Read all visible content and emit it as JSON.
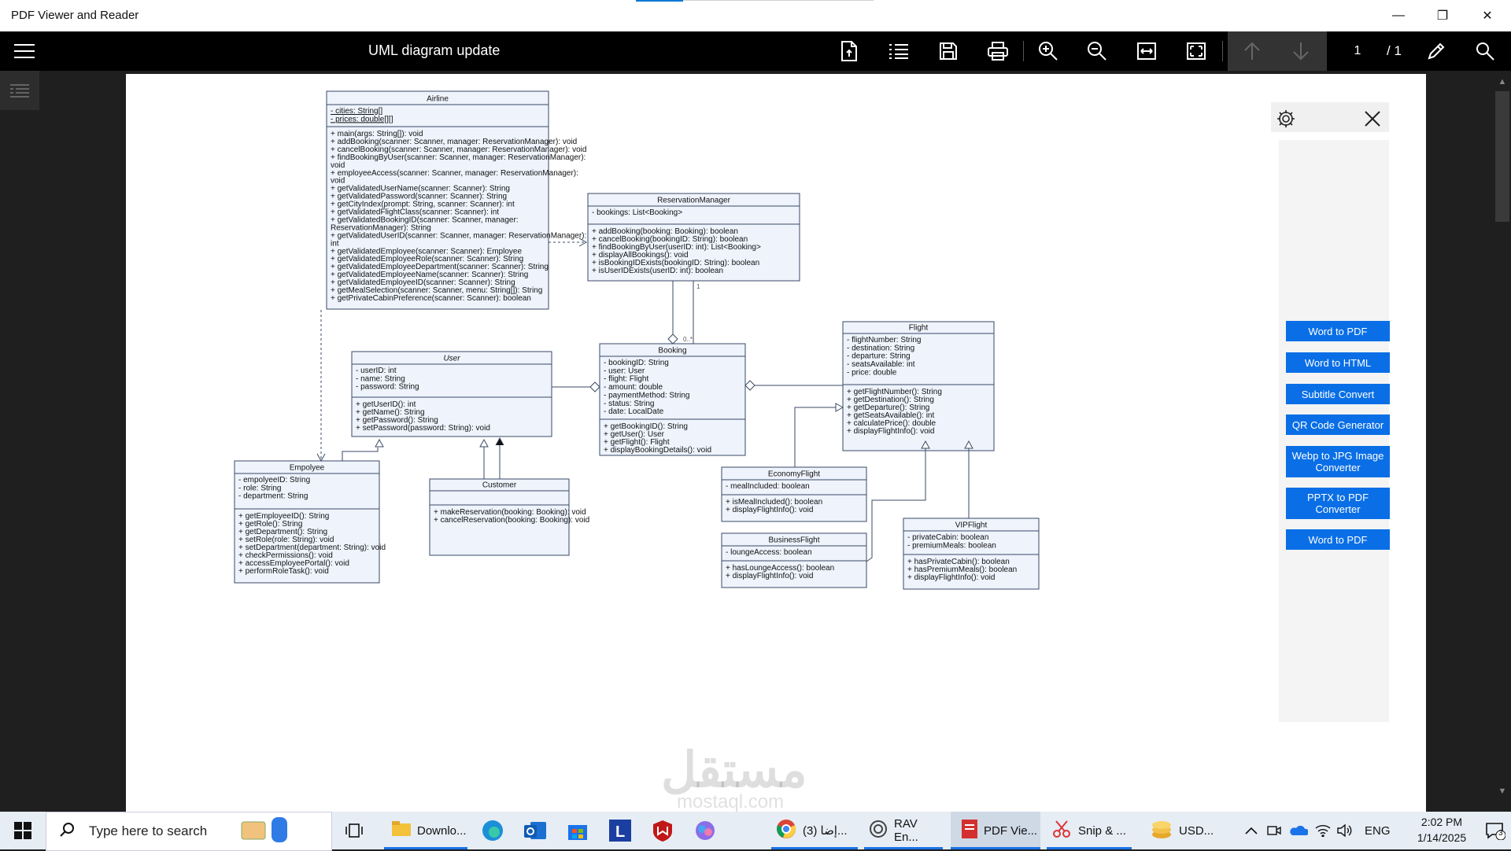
{
  "window": {
    "title": "PDF Viewer and Reader",
    "minimize": "—",
    "maximize": "❐",
    "close": "✕"
  },
  "toolbar": {
    "doc_title": "UML diagram update",
    "page_current": "1",
    "page_total": "/ 1"
  },
  "panel": {
    "buttons": [
      "Word to PDF",
      "Word to HTML",
      "Subtitle Convert",
      "QR Code Generator",
      "Webp to JPG Image Converter",
      "PPTX to PDF Converter",
      "Word to PDF"
    ]
  },
  "uml": {
    "airline": {
      "name": "Airline",
      "attrs": [
        "- cities: String[]",
        "- prices: double[][]"
      ],
      "methods": [
        "+ main(args: String[]): void",
        "+ addBooking(scanner: Scanner, manager: ReservationManager): void",
        "+ cancelBooking(scanner: Scanner, manager: ReservationManager): void",
        "+ findBookingByUser(scanner: Scanner, manager: ReservationManager):",
        "void",
        "+ employeeAccess(scanner: Scanner, manager: ReservationManager):",
        "void",
        "+ getValidatedUserName(scanner: Scanner): String",
        "+ getValidatedPassword(scanner: Scanner): String",
        "+ getCityIndex(prompt: String, scanner: Scanner): int",
        "+ getValidatedFlightClass(scanner: Scanner): int",
        "+ getValidatedBookingID(scanner: Scanner, manager:",
        "ReservationManager): String",
        "+ getValidatedUserID(scanner: Scanner, manager: ReservationManager):",
        "int",
        "+ getValidatedEmployee(scanner: Scanner): Employee",
        "+ getValidatedEmployeeRole(scanner: Scanner): String",
        "+ getValidatedEmployeeDepartment(scanner: Scanner): String",
        "+ getValidatedEmployeeName(scanner: Scanner): String",
        "+ getValidatedEmployeeID(scanner: Scanner): String",
        "+ getMealSelection(scanner: Scanner, menu: String[]): String",
        "+ getPrivateCabinPreference(scanner: Scanner): boolean"
      ]
    },
    "reservation": {
      "name": "ReservationManager",
      "attrs": [
        "- bookings: List<Booking>"
      ],
      "methods": [
        "+ addBooking(booking: Booking): boolean",
        "+ cancelBooking(bookingID: String): boolean",
        "+ findBookingByUser(userID: int): List<Booking>",
        "+ displayAllBookings(): void",
        "+ isBookingIDExists(bookingID: String): boolean",
        "+ isUserIDExists(userID: int): boolean"
      ]
    },
    "user": {
      "name": "User",
      "attrs": [
        "- userID: int",
        "- name: String",
        "- password: String"
      ],
      "methods": [
        "+ getUserID(): int",
        "+ getName(): String",
        "+ getPassword(): String",
        "+ setPassword(password: String): void"
      ]
    },
    "booking": {
      "name": "Booking",
      "attrs": [
        "- bookingID: String",
        "- user: User",
        "- flight: Flight",
        "- amount: double",
        "- paymentMethod: String",
        "- status: String",
        "- date: LocalDate"
      ],
      "methods": [
        "+ getBookingID(): String",
        "+ getUser(): User",
        "+ getFlight(): Flight",
        "+ displayBookingDetails(): void"
      ]
    },
    "flight": {
      "name": "Flight",
      "attrs": [
        "- flightNumber: String",
        "- destination: String",
        "- departure: String",
        "- seatsAvailable: int",
        "- price: double"
      ],
      "methods": [
        "+ getFlightNumber(): String",
        "+ getDestination(): String",
        "+ getDeparture(): String",
        "+ getSeatsAvailable(): int",
        "+ calculatePrice(): double",
        "+ displayFlightInfo(): void"
      ]
    },
    "employee": {
      "name": "Empolyee",
      "attrs": [
        "- empolyeeID: String",
        "- role: String",
        "- department: String"
      ],
      "methods": [
        "+ getEmployeeID(): String",
        "+ getRole(): String",
        "+ getDepartment(): String",
        "+ setRole(role: String): void",
        "+ setDepartment(department: String): void",
        "+ checkPermissions(): void",
        "+ accessEmployeePortal(): void",
        "+ performRoleTask(): void"
      ]
    },
    "customer": {
      "name": "Customer",
      "attrs": [],
      "methods": [
        "+ makeReservation(booking: Booking): void",
        "+ cancelReservation(booking: Booking): void"
      ]
    },
    "economy": {
      "name": "EconomyFlight",
      "attrs": [
        "- mealIncluded: boolean"
      ],
      "methods": [
        "+ isMealIncluded(): boolean",
        "+ displayFlightInfo(): void"
      ]
    },
    "business": {
      "name": "BusinessFlight",
      "attrs": [
        "- loungeAccess: boolean"
      ],
      "methods": [
        "+ hasLoungeAccess(): boolean",
        "+ displayFlightInfo(): void"
      ]
    },
    "vip": {
      "name": "VIPFlight",
      "attrs": [
        "- privateCabin: boolean",
        "- premiumMeals: boolean"
      ],
      "methods": [
        "+ hasPrivateCabin(): boolean",
        "+ hasPremiumMeals(): boolean",
        "+ displayFlightInfo(): void"
      ]
    },
    "mult_one": "1",
    "mult_many": "0..*"
  },
  "watermark": {
    "arabic": "مستقل",
    "latin": "mostaql.com"
  },
  "taskbar": {
    "search_placeholder": "Type here to search",
    "items": [
      "Downlo...",
      "(3) إضا...",
      "RAV En...",
      "PDF Vie...",
      "Snip & ...",
      "USD..."
    ],
    "language": "ENG",
    "time": "2:02 PM",
    "date": "1/14/2025",
    "notifications": "3"
  }
}
